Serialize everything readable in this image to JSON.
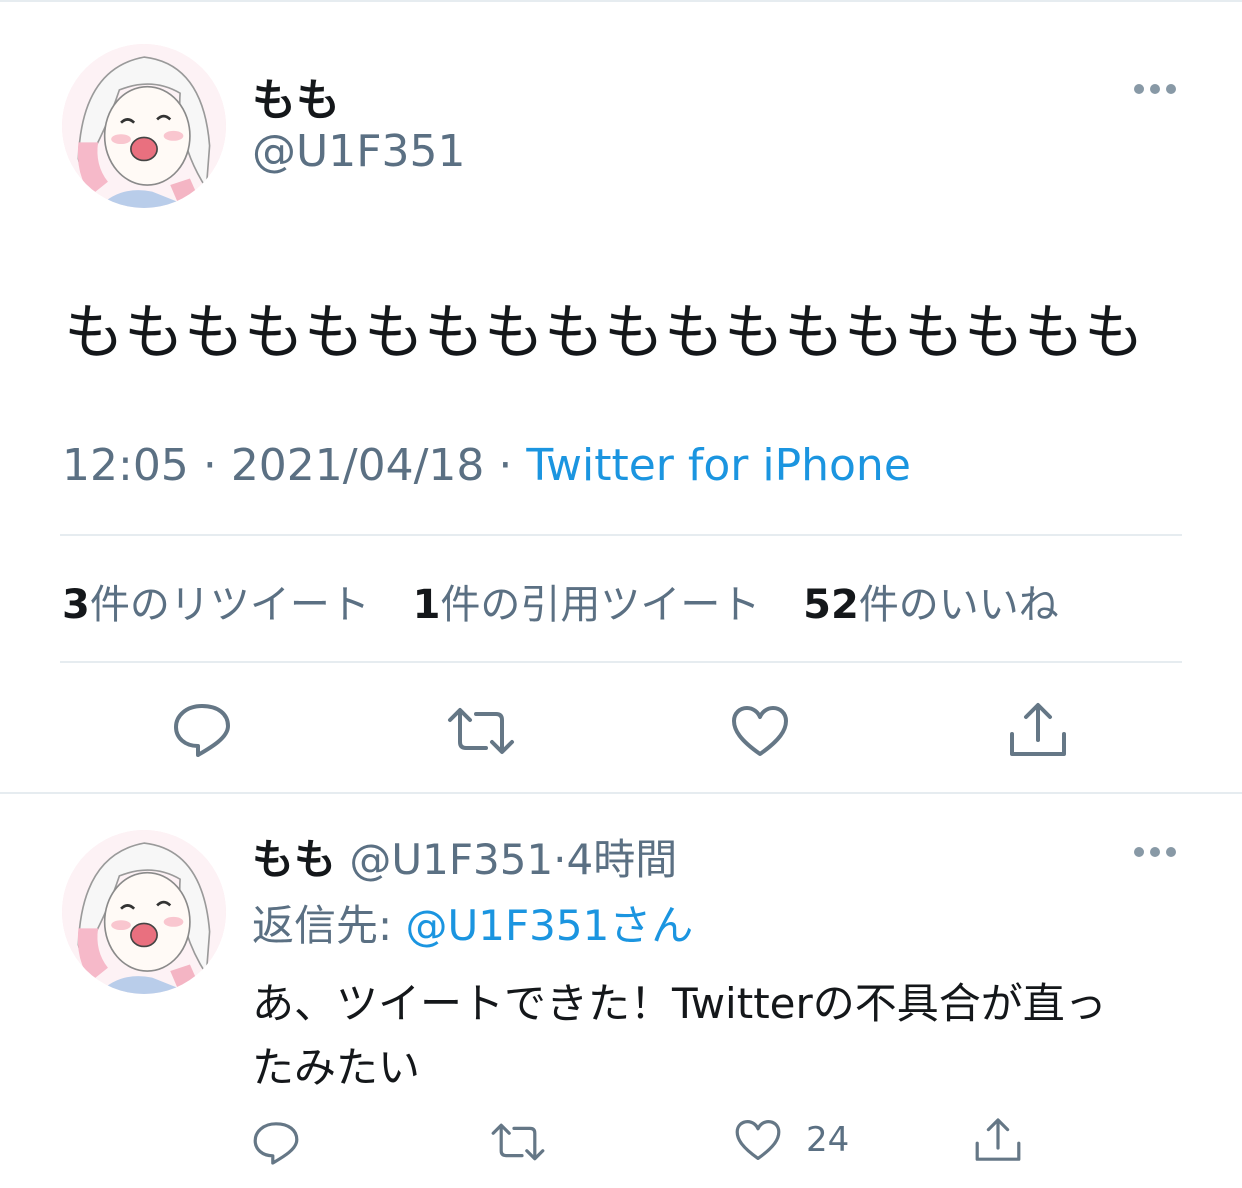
{
  "main_tweet": {
    "display_name": "もも",
    "handle": "@U1F351",
    "text": "もももももももももももももももももも",
    "time": "12:05",
    "separator": "·",
    "date": "2021/04/18",
    "source": "Twitter for iPhone",
    "stats": {
      "retweets_count": "3",
      "retweets_label": "件のリツイート",
      "quotes_count": "1",
      "quotes_label": "件の引用ツイート",
      "likes_count": "52",
      "likes_label": "件のいいね"
    }
  },
  "reply_tweet": {
    "display_name": "もも",
    "handle": "@U1F351",
    "separator": "·",
    "time_ago": "4時間",
    "replying_to_label": "返信先:",
    "replying_to_user": "@U1F351さん",
    "text_line1": "あ、ツイートできた！Twitterの不具合が直っ",
    "text_line2": "たみたい",
    "like_count": "24"
  },
  "icons": [
    "more-icon",
    "reply-icon",
    "retweet-icon",
    "like-icon",
    "share-icon"
  ],
  "colors": {
    "accent": "#1b95e0",
    "secondary_text": "#5b7083",
    "icon": "#657786",
    "divider": "#e6ecf0"
  }
}
